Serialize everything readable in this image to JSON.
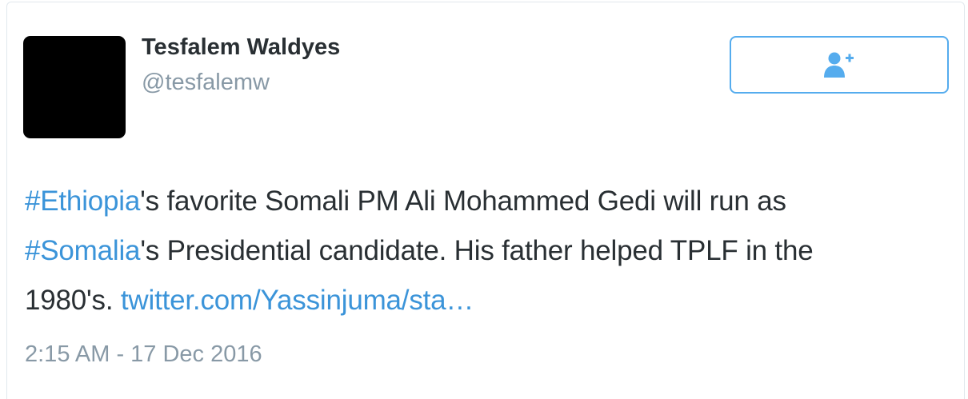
{
  "author": {
    "name": "Tesfalem Waldyes",
    "handle": "@tesfalemw"
  },
  "follow_button": {
    "icon": "follow-person-plus-icon",
    "color": "#55acee"
  },
  "tweet": {
    "lines": [
      [
        {
          "text": "#Ethiopia",
          "link": true
        },
        {
          "text": "'s favorite Somali PM Ali Mohammed Gedi will run as",
          "link": false
        }
      ],
      [
        {
          "text": "#Somalia",
          "link": true
        },
        {
          "text": "'s Presidential candidate. His father helped TPLF in the",
          "link": false
        }
      ],
      [
        {
          "text": "1980's. ",
          "link": false
        },
        {
          "text": "twitter.com/Yassinjuma/sta…",
          "link": true
        }
      ]
    ],
    "timestamp": "2:15 AM - 17 Dec 2016"
  },
  "colors": {
    "link": "#3b94d9",
    "text": "#292f33",
    "muted": "#8899a6",
    "border": "#e1e8ed"
  }
}
